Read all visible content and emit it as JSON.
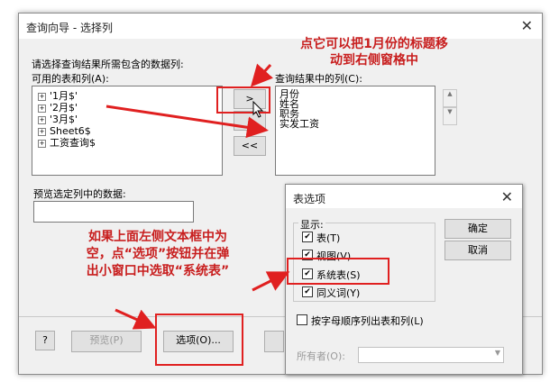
{
  "main_dialog": {
    "title": "查询向导 - 选择列",
    "instruction": "请选择查询结果所需包含的数据列:",
    "available_label": "可用的表和列(A):",
    "available_items": [
      "'1月$'",
      "'2月$'",
      "'3月$'",
      "Sheet6$",
      "工资查询$"
    ],
    "selected_label": "查询结果中的列(C):",
    "selected_items": [
      "月份",
      "姓名",
      "职务",
      "实发工资"
    ],
    "preview_label": "预览选定列中的数据:",
    "add_button": ">",
    "remove_all_button": "<<",
    "help_button": "?",
    "preview_button": "预览(P)",
    "options_button": "选项(O)..."
  },
  "options_dialog": {
    "title": "表选项",
    "group_label": "显示:",
    "checkboxes": [
      {
        "label": "表(T)",
        "checked": true
      },
      {
        "label": "视图(V)",
        "checked": true
      },
      {
        "label": "系统表(S)",
        "checked": true
      },
      {
        "label": "同义词(Y)",
        "checked": true
      }
    ],
    "ok_button": "确定",
    "cancel_button": "取消",
    "alpha_sort_label": "按字母顺序列出表和列(L)",
    "owner_label": "所有者(O):"
  },
  "annotations": {
    "top_note_line1": "点它可以把1月份的标题移",
    "top_note_line2": "动到右侧窗格中",
    "bottom_note_line1": "如果上面左侧文本框中为",
    "bottom_note_line2": "空，点“选项”按钮并在弹",
    "bottom_note_line3": "出小窗口中选取“系统表”"
  }
}
